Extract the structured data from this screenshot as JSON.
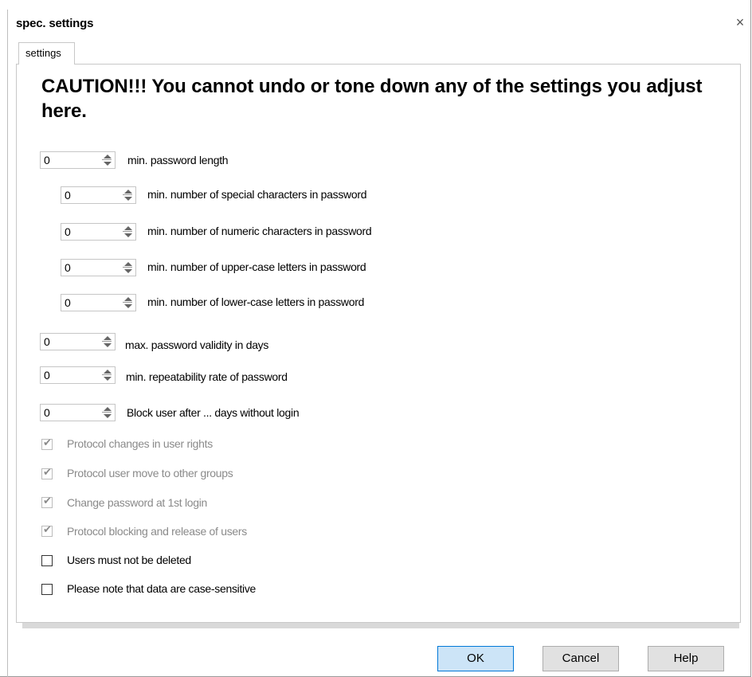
{
  "dialog": {
    "title": "spec. settings",
    "close_symbol": "×"
  },
  "tabs": [
    {
      "label": "settings"
    }
  ],
  "caution_text": "CAUTION!!! You cannot undo or tone down any of the settings you adjust here.",
  "spinners": [
    {
      "value": "0",
      "label": "min. password length"
    },
    {
      "value": "0",
      "label": "min. number of special characters in password"
    },
    {
      "value": "0",
      "label": "min. number of numeric characters in password"
    },
    {
      "value": "0",
      "label": "min. number of upper-case letters in password"
    },
    {
      "value": "0",
      "label": "min. number of lower-case letters in password"
    },
    {
      "value": "0",
      "label": "max. password validity in days"
    },
    {
      "value": "0",
      "label": "min. repeatability rate of password"
    },
    {
      "value": "0",
      "label": "Block user after ... days without login"
    }
  ],
  "checkboxes": [
    {
      "label": "Protocol changes in user rights",
      "checked": true,
      "enabled": false
    },
    {
      "label": "Protocol user move to other groups",
      "checked": true,
      "enabled": false
    },
    {
      "label": "Change password at 1st login",
      "checked": true,
      "enabled": false
    },
    {
      "label": "Protocol blocking and release of users",
      "checked": true,
      "enabled": false
    },
    {
      "label": "Users must not be deleted",
      "checked": false,
      "enabled": true
    },
    {
      "label": "Please note that data are case-sensitive",
      "checked": false,
      "enabled": true
    }
  ],
  "check_glyph": "✔",
  "buttons": {
    "ok": "OK",
    "cancel": "Cancel",
    "help": "Help"
  },
  "colors": {
    "primary_button_bg": "#cce4f7",
    "primary_button_border": "#0078d7",
    "disabled_text": "#8a8a8a"
  }
}
